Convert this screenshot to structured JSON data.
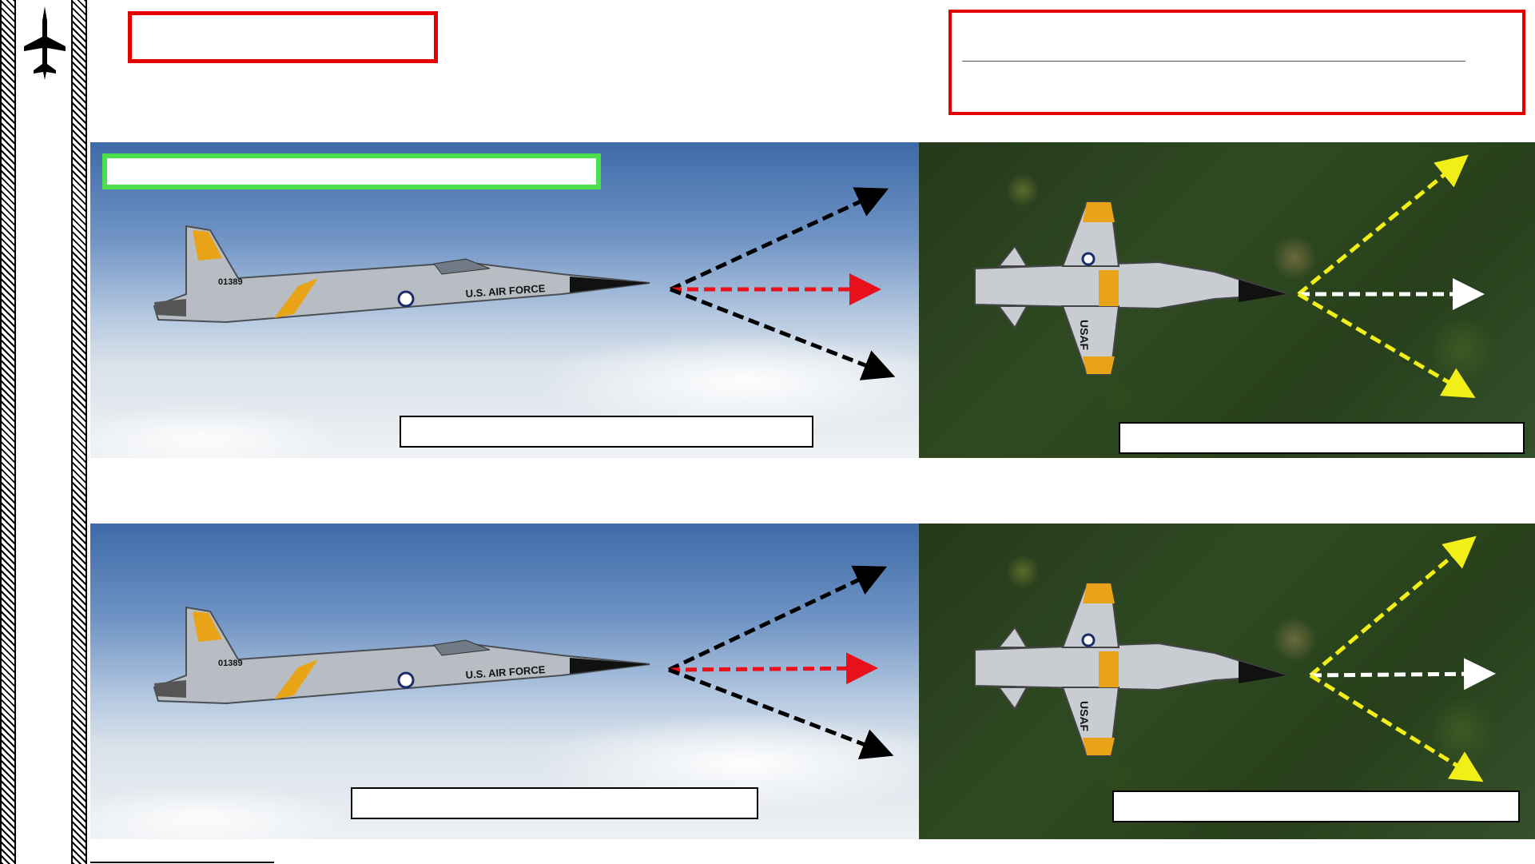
{
  "colors": {
    "title_border": "#e50000",
    "section_label_border": "#4de04d",
    "arrow_black": "#000000",
    "arrow_red": "#e8101a",
    "arrow_yellow": "#f2ee18",
    "arrow_white": "#ffffff",
    "aircraft_accent": "#e8a317"
  },
  "icons": {
    "sidebar_logo": "fighter-jet-silhouette-icon"
  },
  "panels": {
    "side_views": [
      {
        "scene": "sky",
        "aircraft": "side-view",
        "arrows": [
          "black-up",
          "red-forward",
          "black-down"
        ]
      },
      {
        "scene": "sky",
        "aircraft": "side-view",
        "arrows": [
          "black-up",
          "red-forward",
          "black-down"
        ]
      }
    ],
    "top_views": [
      {
        "scene": "forest",
        "aircraft": "top-view",
        "arrows": [
          "yellow-left",
          "white-forward",
          "yellow-right"
        ]
      },
      {
        "scene": "forest",
        "aircraft": "top-view",
        "arrows": [
          "yellow-left",
          "white-forward",
          "yellow-right"
        ]
      }
    ],
    "aircraft_markings": {
      "tail_number": "01389",
      "fuselage_text": "U.S. AIR FORCE",
      "wing_text": "USAF"
    }
  }
}
